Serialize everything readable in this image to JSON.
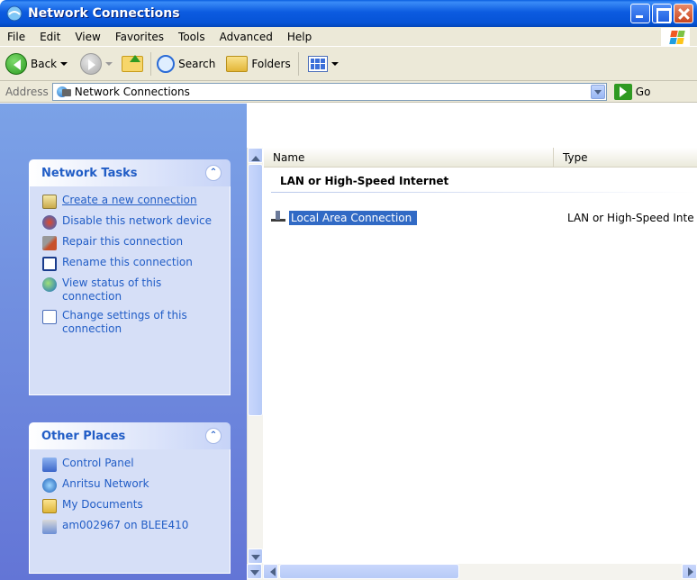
{
  "window": {
    "title": "Network Connections",
    "icon": "network-connections-icon",
    "controls": [
      "minimize",
      "maximize",
      "close"
    ]
  },
  "menu": {
    "items": [
      {
        "label": "File"
      },
      {
        "label": "Edit"
      },
      {
        "label": "View"
      },
      {
        "label": "Favorites"
      },
      {
        "label": "Tools"
      },
      {
        "label": "Advanced"
      },
      {
        "label": "Help"
      }
    ]
  },
  "toolbar": {
    "back_label": "Back",
    "search_label": "Search",
    "folders_label": "Folders"
  },
  "address": {
    "label": "Address",
    "value": "Network Connections",
    "go_label": "Go"
  },
  "network_tasks": {
    "title": "Network Tasks",
    "items": [
      {
        "label": "Create a new connection",
        "icon": "new-connection-icon"
      },
      {
        "label": "Disable this network device",
        "icon": "disable-icon"
      },
      {
        "label": "Repair this connection",
        "icon": "repair-icon"
      },
      {
        "label": "Rename this connection",
        "icon": "rename-icon"
      },
      {
        "label": "View status of this connection",
        "icon": "status-icon"
      },
      {
        "label": "Change settings of this connection",
        "icon": "settings-icon"
      }
    ]
  },
  "other_places": {
    "title": "Other Places",
    "items": [
      {
        "label": "Control Panel",
        "icon": "control-panel-icon"
      },
      {
        "label": "Anritsu Network",
        "icon": "network-icon"
      },
      {
        "label": "My Documents",
        "icon": "my-documents-icon"
      },
      {
        "label": "am002967 on BLEE410",
        "icon": "network-drive-icon"
      }
    ]
  },
  "list": {
    "columns": [
      "Name",
      "Type"
    ],
    "group": "LAN or High-Speed Internet",
    "rows": [
      {
        "name": "Local Area Connection",
        "type": "LAN or High-Speed Inte",
        "selected": true
      }
    ]
  },
  "colors": {
    "titlebar": "#0653d6",
    "taskpane": "#7ba2e7",
    "task_link": "#215dc6",
    "selection": "#316ac5"
  }
}
